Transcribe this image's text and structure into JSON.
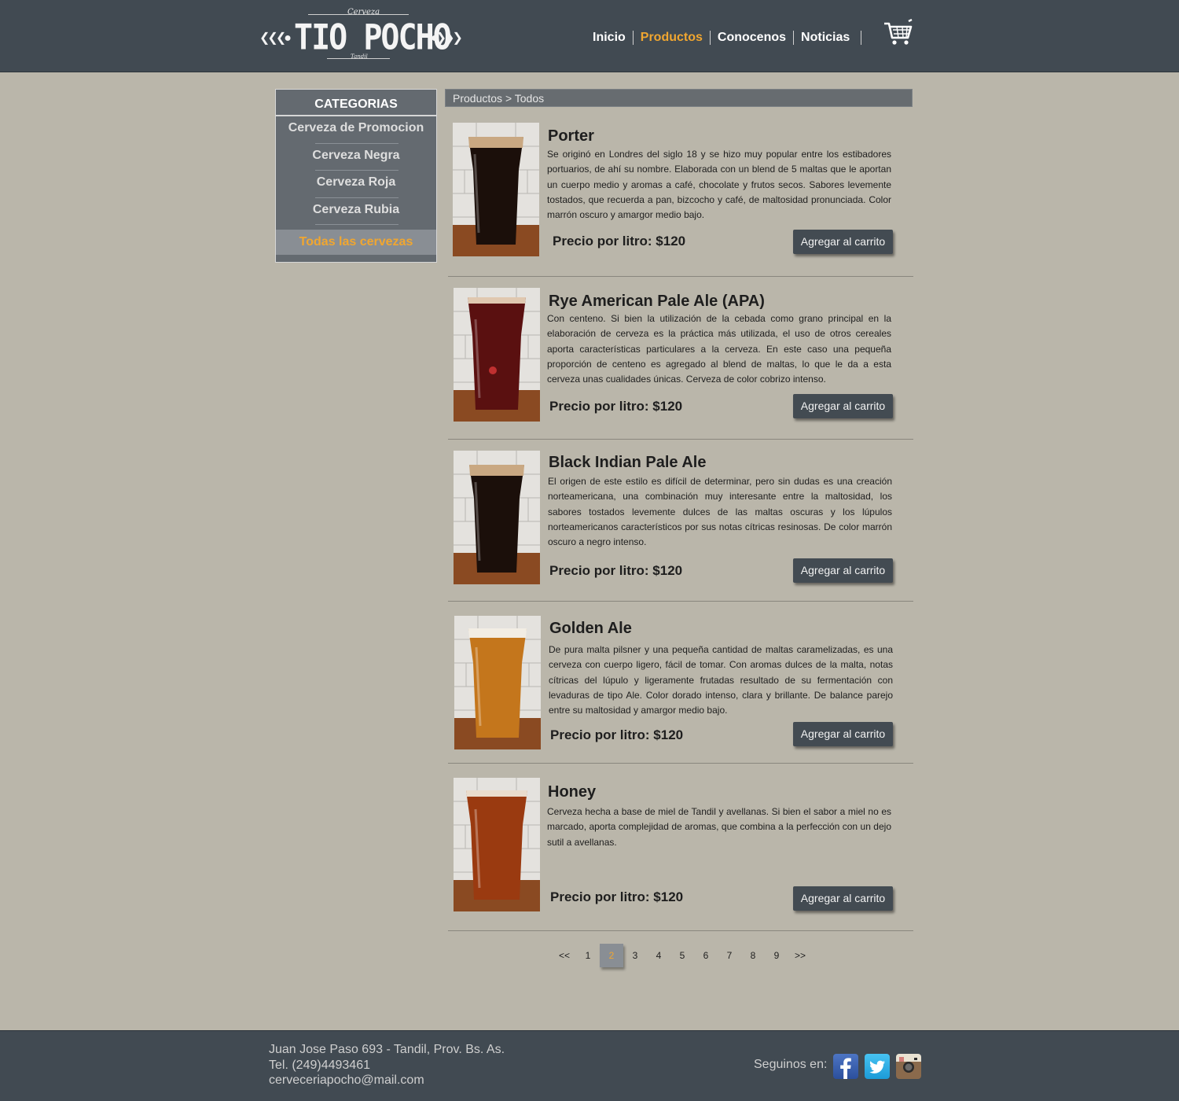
{
  "header": {
    "logo": {
      "brand": "TIO POCHO",
      "script_top": "Cerveza",
      "script_bottom": "Tandil"
    },
    "nav": [
      {
        "label": "Inicio",
        "active": false
      },
      {
        "label": "Productos",
        "active": true
      },
      {
        "label": "Conocenos",
        "active": false
      },
      {
        "label": "Noticias",
        "active": false
      }
    ],
    "cart_icon": "shopping-cart-icon"
  },
  "sidebar": {
    "title": "CATEGORIAS",
    "categories": [
      "Cerveza de Promocion",
      "Cerveza Negra",
      "Cerveza Roja",
      "Cerveza Rubia"
    ],
    "all_label": "Todas las cervezas"
  },
  "breadcrumb": {
    "section": "Productos",
    "separator": ">",
    "current": "Todos"
  },
  "products": [
    {
      "name": "Porter",
      "description": "Se originó en Londres del siglo 18 y se hizo muy popular entre los estibadores portuarios, de ahí su nombre. Elaborada con un blend de 5 maltas que le aportan un cuerpo medio y aromas a café, chocolate y frutos secos. Sabores levemente tostados, que recuerda a pan, bizcocho y café, de maltosidad pronunciada. Color marrón oscuro y amargor medio bajo.",
      "price": "Precio por litro: $120",
      "button": "Agregar al carrito",
      "beer_color": "#1b0f0a"
    },
    {
      "name": "Rye American Pale Ale (APA)",
      "description": "Con centeno. Si bien la utilización de la cebada como grano principal en la elaboración de cerveza es la práctica más utilizada, el uso de otros cereales aporta características particulares a la cerveza. En este caso una pequeña proporción de centeno es agregado al blend de maltas, lo que le da a esta cerveza unas cualidades únicas. Cerveza de color cobrizo intenso.",
      "price": "Precio por litro: $120",
      "button": "Agregar al carrito",
      "beer_color": "#5a1010"
    },
    {
      "name": "Black Indian Pale Ale",
      "description": "El origen de este estilo es difícil de determinar, pero sin dudas es una creación norteamericana, una combinación muy interesante entre la maltosidad, los sabores tostados levemente dulces de las maltas oscuras y los lúpulos norteamericanos característicos por sus notas cítricas resinosas. De color marrón oscuro a negro intenso.",
      "price": "Precio por litro: $120",
      "button": "Agregar al carrito",
      "beer_color": "#1b0f0a"
    },
    {
      "name": "Golden Ale",
      "description": "De pura malta pilsner y una pequeña cantidad de maltas caramelizadas, es una cerveza con cuerpo ligero, fácil de tomar. Con aromas dulces de la malta, notas cítricas del lúpulo y ligeramente frutadas resultado de su fermentación con levaduras de tipo Ale. Color dorado intenso, clara y brillante. De balance parejo entre su maltosidad y amargor medio bajo.",
      "price": "Precio por litro: $120",
      "button": "Agregar al carrito",
      "beer_color": "#c4761c"
    },
    {
      "name": "Honey",
      "description": "Cerveza hecha a base de miel de Tandil y avellanas. Si bien el sabor a miel no es marcado, aporta complejidad de aromas, que combina a la perfección con un dejo sutil a avellanas.",
      "price": "Precio por litro: $120",
      "button": "Agregar al carrito",
      "beer_color": "#9a3a10"
    }
  ],
  "pagination": {
    "prev": "<<",
    "pages": [
      "1",
      "2",
      "3",
      "4",
      "5",
      "6",
      "7",
      "8",
      "9"
    ],
    "current": "2",
    "next": ">>"
  },
  "footer": {
    "address": "Juan Jose Paso 693 - Tandil, Prov. Bs. As.",
    "phone": "Tel. (249)4493461",
    "email": "cerveceriapocho@mail.com",
    "follow_label": "Seguinos en:",
    "social": [
      "facebook-icon",
      "twitter-icon",
      "instagram-icon"
    ]
  },
  "colors": {
    "header_bg": "#414a52",
    "page_bg": "#bab6aa",
    "accent": "#f0a630",
    "button_bg": "#434b52"
  }
}
